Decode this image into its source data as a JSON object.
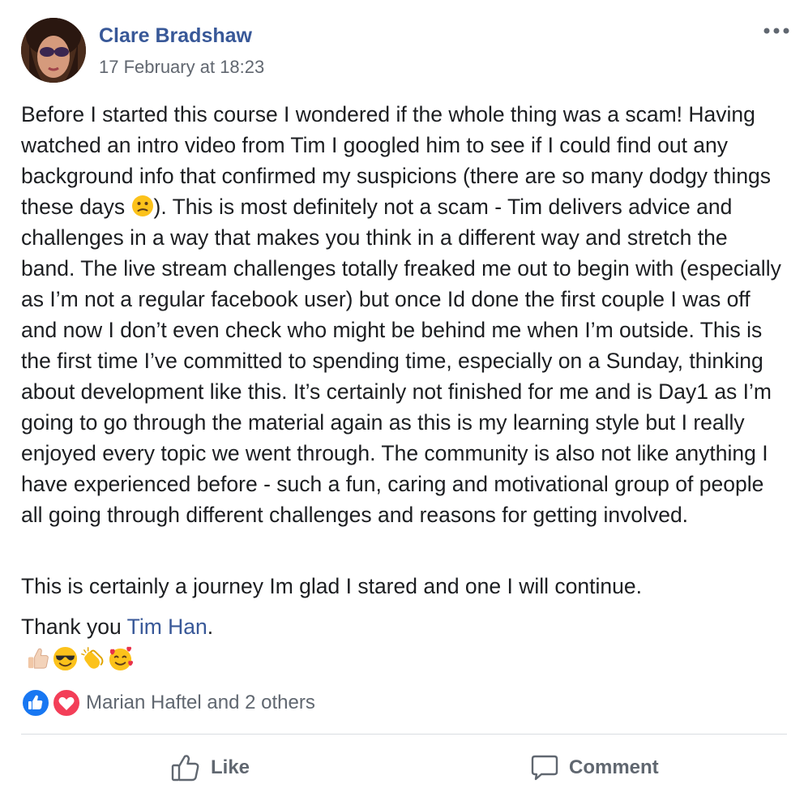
{
  "post": {
    "author": "Clare Bradshaw",
    "timestamp": "17 February at 18:23",
    "more_icon": "more-horizontal-icon",
    "body": {
      "p1_a": "Before I started this course I wondered if the whole thing was a scam! Having watched an intro video from Tim I googled him to see if I could find out any background info that confirmed my suspicions (there are so many dodgy things these days ",
      "p1_emoji": "confused-face-emoji",
      "p1_b": "). This is most definitely not a scam - Tim delivers advice and challenges in a way that makes you think in a different way and stretch the band. The live stream challenges totally freaked me out to begin with (especially as I’m not a regular facebook user) but once Id done the first couple I was off and now I don’t even check who might be behind me when I’m outside. This is the first time I’ve committed to spending time, especially on a Sunday, thinking about development like this. It’s certainly not finished for me and is Day1 as I’m going to go through the material again as this is my learning style but I really enjoyed every topic we went through. The community is also not like anything I have experienced before - such a fun, caring and motivational group of people all going through different challenges and reasons for getting involved.",
      "p2": "This is certainly a journey Im glad I stared and one I will continue.",
      "p3_prefix": "Thank you ",
      "p3_mention": "Tim Han",
      "p3_suffix": ".",
      "emojis": [
        "thumbs-up-emoji",
        "smiling-face-with-sunglasses-emoji",
        "clapping-hands-emoji",
        "smiling-face-with-hearts-emoji"
      ]
    },
    "reactions": {
      "icons": [
        "like-reaction-icon",
        "love-reaction-icon"
      ],
      "summary": "Marian Haftel and 2 others"
    },
    "actions": {
      "like_label": "Like",
      "comment_label": "Comment"
    },
    "colors": {
      "link": "#385898",
      "secondary_text": "#616770",
      "like_blue": "#1877f2",
      "love_red": "#f33e58",
      "divider": "#dadde1"
    }
  }
}
